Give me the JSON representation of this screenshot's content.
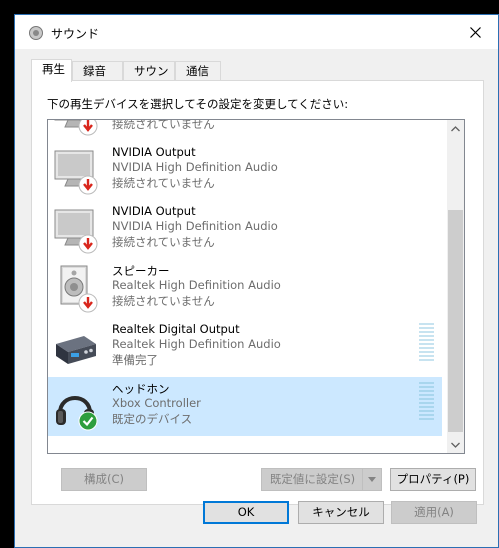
{
  "window": {
    "title": "サウンド"
  },
  "tabs": [
    {
      "label": "再生"
    },
    {
      "label": "録音"
    },
    {
      "label": "サウンド"
    },
    {
      "label": "通信"
    }
  ],
  "panel": {
    "instruction": "下の再生デバイスを選択してその設定を変更してください:"
  },
  "devices": [
    {
      "name": "",
      "driver": "",
      "status": "接続されていません",
      "icon": "monitor-icon",
      "state": "disconnected"
    },
    {
      "name": "NVIDIA Output",
      "driver": "NVIDIA High Definition Audio",
      "status": "接続されていません",
      "icon": "monitor-icon",
      "state": "disconnected"
    },
    {
      "name": "NVIDIA Output",
      "driver": "NVIDIA High Definition Audio",
      "status": "接続されていません",
      "icon": "monitor-icon",
      "state": "disconnected"
    },
    {
      "name": "スピーカー",
      "driver": "Realtek High Definition Audio",
      "status": "接続されていません",
      "icon": "speaker-icon",
      "state": "disconnected"
    },
    {
      "name": "Realtek Digital Output",
      "driver": "Realtek High Definition Audio",
      "status": "準備完了",
      "icon": "digital-output-icon",
      "state": "ready"
    },
    {
      "name": "ヘッドホン",
      "driver": "Xbox Controller",
      "status": "既定のデバイス",
      "icon": "headphones-icon",
      "state": "default"
    }
  ],
  "buttons": {
    "configure": "構成(C)",
    "set_default": "既定値に設定(S)",
    "properties": "プロパティ(P)",
    "ok": "OK",
    "cancel": "キャンセル",
    "apply": "適用(A)"
  },
  "colors": {
    "selection": "#cce8ff",
    "accent": "#0078d7",
    "disconnected_badge": "#d9261c",
    "default_badge": "#2e9e3e"
  }
}
